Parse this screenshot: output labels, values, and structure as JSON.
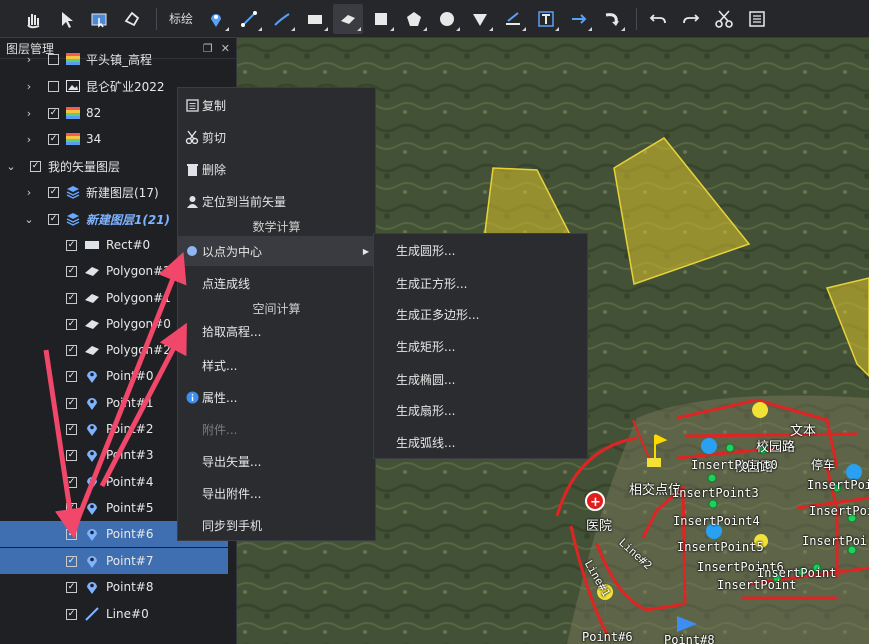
{
  "toolbar": {
    "mark_label": "标绘",
    "tools": [
      {
        "icon": "pan-hand-icon"
      },
      {
        "icon": "select-pointer-icon"
      },
      {
        "icon": "box-select-icon"
      },
      {
        "icon": "polygon-select-icon"
      },
      {
        "icon": "point-marker-icon"
      },
      {
        "icon": "polyline-icon"
      },
      {
        "icon": "freehand-line-icon"
      },
      {
        "icon": "rectangle-icon"
      },
      {
        "icon": "filled-polygon-icon"
      },
      {
        "icon": "square-icon"
      },
      {
        "icon": "pentagon-icon"
      },
      {
        "icon": "circle-icon"
      },
      {
        "icon": "funnel-icon"
      },
      {
        "icon": "measure-ruler-icon"
      },
      {
        "icon": "text-box-icon"
      },
      {
        "icon": "arrow-icon"
      },
      {
        "icon": "curved-arrow-icon"
      },
      {
        "icon": "undo-icon"
      },
      {
        "icon": "redo-icon"
      },
      {
        "icon": "scissors-icon"
      },
      {
        "icon": "list-icon"
      }
    ]
  },
  "panel": {
    "title": "图层管理",
    "rows": [
      {
        "label": "平头镇_高程",
        "icon": "raster-layer-icon",
        "arrow": "›",
        "checked": false
      },
      {
        "label": "昆仑矿业2022",
        "icon": "image-layer-icon",
        "arrow": "›",
        "checked": false
      },
      {
        "label": "82",
        "icon": "raster-layer-icon",
        "arrow": "›",
        "checked": true
      },
      {
        "label": "34",
        "icon": "raster-layer-icon",
        "arrow": "›",
        "checked": true
      },
      {
        "label": "我的矢量图层",
        "icon": "",
        "arrow": "⌄",
        "checked": true
      },
      {
        "label": "新建图层(17)",
        "icon": "layers-stack-icon",
        "arrow": "›",
        "checked": true
      },
      {
        "label": "新建图层1(21)",
        "icon": "layers-stack-icon",
        "arrow": "⌄",
        "checked": true
      },
      {
        "label": "Rect#0",
        "icon": "rect-feature-icon",
        "arrow": "",
        "checked": true
      },
      {
        "label": "Polygon#2",
        "icon": "polygon-feature-icon",
        "arrow": "",
        "checked": true
      },
      {
        "label": "Polygon#1",
        "icon": "polygon-feature-icon",
        "arrow": "",
        "checked": true
      },
      {
        "label": "Polygon#0",
        "icon": "polygon-feature-icon",
        "arrow": "",
        "checked": true
      },
      {
        "label": "Polygon#2",
        "icon": "polygon-feature-icon",
        "arrow": "",
        "checked": true
      },
      {
        "label": "Point#0",
        "icon": "point-feature-icon",
        "arrow": "",
        "checked": true
      },
      {
        "label": "Point#1",
        "icon": "point-feature-icon",
        "arrow": "",
        "checked": true
      },
      {
        "label": "Point#2",
        "icon": "point-feature-icon",
        "arrow": "",
        "checked": true
      },
      {
        "label": "Point#3",
        "icon": "point-feature-icon",
        "arrow": "",
        "checked": true
      },
      {
        "label": "Point#4",
        "icon": "point-feature-icon",
        "arrow": "",
        "checked": true
      },
      {
        "label": "Point#5",
        "icon": "point-feature-icon",
        "arrow": "",
        "checked": true
      },
      {
        "label": "Point#6",
        "icon": "point-feature-icon",
        "arrow": "",
        "checked": true
      },
      {
        "label": "Point#7",
        "icon": "point-feature-icon",
        "arrow": "",
        "checked": true
      },
      {
        "label": "Point#8",
        "icon": "point-feature-icon",
        "arrow": "",
        "checked": true
      },
      {
        "label": "Line#0",
        "icon": "line-feature-icon",
        "arrow": "",
        "checked": true
      }
    ]
  },
  "context_menu": {
    "copy": "复制",
    "cut": "剪切",
    "delete": "删除",
    "locate": "定位到当前矢量",
    "math_header": "数学计算",
    "point_center": "以点为中心",
    "connect_points": "点连成线",
    "space_header": "空间计算",
    "pick_elevation": "拾取高程...",
    "style": "样式...",
    "properties": "属性...",
    "attachments": "附件...",
    "export_vector": "导出矢量...",
    "export_attachment": "导出附件...",
    "sync_phone": "同步到手机"
  },
  "submenu": {
    "items": [
      "生成圆形...",
      "生成正方形...",
      "生成正多边形...",
      "生成矩形...",
      "生成椭圆...",
      "生成扇形...",
      "生成弧线..."
    ]
  },
  "map": {
    "labels": {
      "text": "文本",
      "campus_road": "校园路",
      "campus_road_2": "校园路",
      "intersection": "相交点位",
      "hospital": "医院",
      "line1": "Line#1",
      "line2": "Line#2",
      "point6": "Point#6",
      "point8": "Point#8",
      "insert0": "InsertPoint0",
      "insert3": "InsertPoint3",
      "insert4": "InsertPoint4",
      "insert5": "InsertPoint5",
      "insert6": "InsertPoint6",
      "insert_r1": "InsertPoi",
      "insert_r2": "InsertPoi",
      "insert_r3": "InsertPoi",
      "insert_r4": "InsertPoint",
      "insert_r5": "InsertPoint",
      "stop": "停车",
      "partial_a": "InsertPoint",
      "partial_b": "InsertPoint"
    }
  },
  "colors": {
    "accent": "#3f6fb0",
    "annotation_arrow": "#f0476a",
    "vector_yellow": "#d8c12a",
    "road_red": "#e02424"
  }
}
